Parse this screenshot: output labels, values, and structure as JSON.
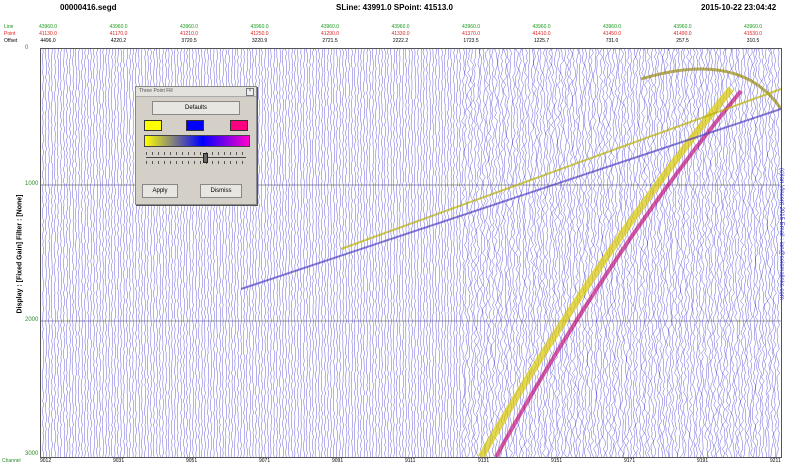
{
  "header": {
    "filename": "00000416.segd",
    "sline_spoint": "SLine: 43991.0  SPoint: 41513.0",
    "datetime": "2015-10-22 23:04:42"
  },
  "row_labels": {
    "line": "Line",
    "point": "Point",
    "offset": "Offset"
  },
  "columns": [
    {
      "line": "43960.0",
      "point": "41130.0",
      "offset": "4496.0"
    },
    {
      "line": "43960.0",
      "point": "41170.0",
      "offset": "4220.2"
    },
    {
      "line": "43960.0",
      "point": "41210.0",
      "offset": "3720.5"
    },
    {
      "line": "43960.0",
      "point": "41250.0",
      "offset": "3220.9"
    },
    {
      "line": "43960.0",
      "point": "41290.0",
      "offset": "2721.5"
    },
    {
      "line": "43960.0",
      "point": "41330.0",
      "offset": "2222.2"
    },
    {
      "line": "43960.0",
      "point": "41370.0",
      "offset": "1723.5"
    },
    {
      "line": "43960.0",
      "point": "41410.0",
      "offset": "1225.7"
    },
    {
      "line": "43960.0",
      "point": "41450.0",
      "offset": "731.0"
    },
    {
      "line": "43960.0",
      "point": "41490.0",
      "offset": "257.5"
    },
    {
      "line": "43960.0",
      "point": "41530.0",
      "offset": "310.5"
    }
  ],
  "y_ticks": [
    "0",
    "1000",
    "2000",
    "3000"
  ],
  "x_ticks": [
    "9012",
    "9031",
    "9051",
    "9071",
    "9091",
    "9111",
    "9131",
    "9151",
    "9171",
    "9191",
    "9211"
  ],
  "channel_label": "Channel",
  "left_label": "Display : [Fixed Gain]   Filter : [None]",
  "right_label": "(c)Ian Vincent 2015   Email : ian@seismalinks.com",
  "dialog": {
    "title": "Three Point Fill",
    "defaults_label": "Defaults",
    "apply_label": "Apply",
    "dismiss_label": "Dismiss",
    "colors": [
      "#ffff00",
      "#0000ff",
      "#ff0080"
    ],
    "slider_value_fraction": 0.57
  }
}
